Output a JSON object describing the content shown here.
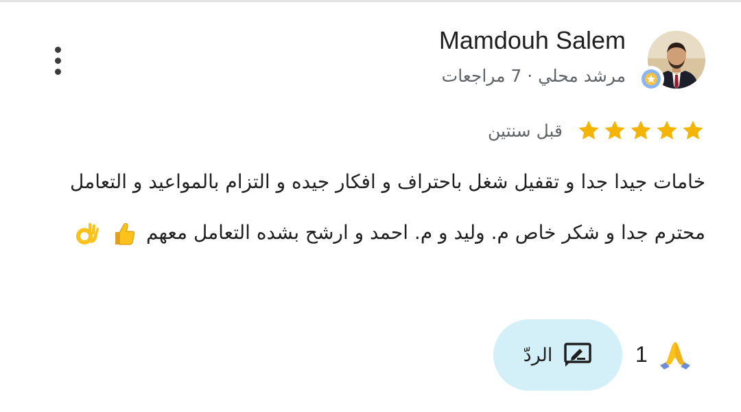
{
  "review": {
    "author_name": "Mamdouh Salem",
    "author_meta": "مرشد محلي · 7 مراجعات",
    "rating": 5,
    "time": "قبل سنتين",
    "text": "خامات جيدا جدا و تقفيل شغل باحتراف و افكار جيده و التزام بالمواعيد و التعامل محترم جدا و شكر خاص م. وليد و م. احمد و ارشح بشده التعامل معهم",
    "emojis": [
      "thumbs-up",
      "ok-hand"
    ]
  },
  "actions": {
    "reply_label": "الردّ",
    "reaction_icon": "praying-hands-icon",
    "reaction_count": "1"
  },
  "colors": {
    "star": "#f4b400",
    "reply_bg": "#d3eff8",
    "meta_text": "#5f6368"
  }
}
